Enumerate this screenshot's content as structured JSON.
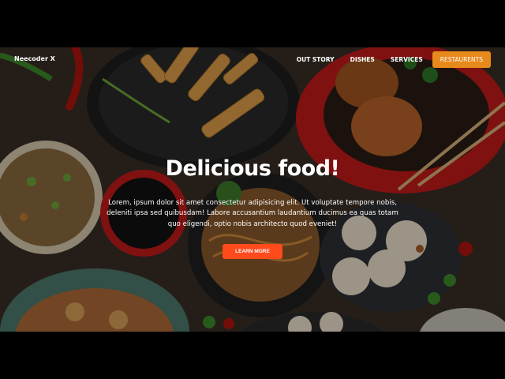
{
  "brand": {
    "name": "Neecoder X"
  },
  "nav": {
    "items": [
      {
        "label": "OUT STORY"
      },
      {
        "label": "DISHES"
      },
      {
        "label": "SERVICES"
      }
    ],
    "cta_label": "RESTAURENTS"
  },
  "hero": {
    "title": "Delicious food!",
    "description": "Lorem, ipsum dolor sit amet consectetur adipisicing elit. Ut voluptate tempore nobis, deleniti ipsa sed quibusdam! Labore accusantium laudantium ducimus ea quas totam quo eligendi, optio nobis architecto quod eveniet!",
    "button_label": "LEARN MORE"
  },
  "colors": {
    "accent": "#e8891c",
    "button": "#ff4a1c",
    "background": "#3b2f27"
  }
}
